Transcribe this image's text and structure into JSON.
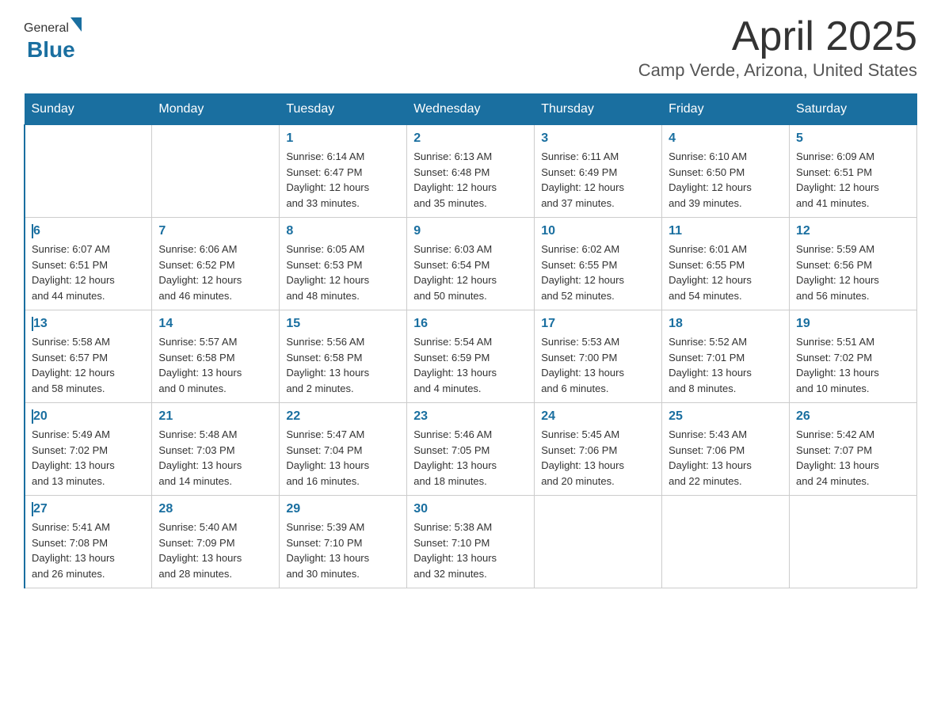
{
  "header": {
    "logo_general": "General",
    "logo_blue": "Blue",
    "month": "April 2025",
    "location": "Camp Verde, Arizona, United States"
  },
  "weekdays": [
    "Sunday",
    "Monday",
    "Tuesday",
    "Wednesday",
    "Thursday",
    "Friday",
    "Saturday"
  ],
  "weeks": [
    [
      {
        "day": "",
        "info": ""
      },
      {
        "day": "",
        "info": ""
      },
      {
        "day": "1",
        "info": "Sunrise: 6:14 AM\nSunset: 6:47 PM\nDaylight: 12 hours\nand 33 minutes."
      },
      {
        "day": "2",
        "info": "Sunrise: 6:13 AM\nSunset: 6:48 PM\nDaylight: 12 hours\nand 35 minutes."
      },
      {
        "day": "3",
        "info": "Sunrise: 6:11 AM\nSunset: 6:49 PM\nDaylight: 12 hours\nand 37 minutes."
      },
      {
        "day": "4",
        "info": "Sunrise: 6:10 AM\nSunset: 6:50 PM\nDaylight: 12 hours\nand 39 minutes."
      },
      {
        "day": "5",
        "info": "Sunrise: 6:09 AM\nSunset: 6:51 PM\nDaylight: 12 hours\nand 41 minutes."
      }
    ],
    [
      {
        "day": "6",
        "info": "Sunrise: 6:07 AM\nSunset: 6:51 PM\nDaylight: 12 hours\nand 44 minutes."
      },
      {
        "day": "7",
        "info": "Sunrise: 6:06 AM\nSunset: 6:52 PM\nDaylight: 12 hours\nand 46 minutes."
      },
      {
        "day": "8",
        "info": "Sunrise: 6:05 AM\nSunset: 6:53 PM\nDaylight: 12 hours\nand 48 minutes."
      },
      {
        "day": "9",
        "info": "Sunrise: 6:03 AM\nSunset: 6:54 PM\nDaylight: 12 hours\nand 50 minutes."
      },
      {
        "day": "10",
        "info": "Sunrise: 6:02 AM\nSunset: 6:55 PM\nDaylight: 12 hours\nand 52 minutes."
      },
      {
        "day": "11",
        "info": "Sunrise: 6:01 AM\nSunset: 6:55 PM\nDaylight: 12 hours\nand 54 minutes."
      },
      {
        "day": "12",
        "info": "Sunrise: 5:59 AM\nSunset: 6:56 PM\nDaylight: 12 hours\nand 56 minutes."
      }
    ],
    [
      {
        "day": "13",
        "info": "Sunrise: 5:58 AM\nSunset: 6:57 PM\nDaylight: 12 hours\nand 58 minutes."
      },
      {
        "day": "14",
        "info": "Sunrise: 5:57 AM\nSunset: 6:58 PM\nDaylight: 13 hours\nand 0 minutes."
      },
      {
        "day": "15",
        "info": "Sunrise: 5:56 AM\nSunset: 6:58 PM\nDaylight: 13 hours\nand 2 minutes."
      },
      {
        "day": "16",
        "info": "Sunrise: 5:54 AM\nSunset: 6:59 PM\nDaylight: 13 hours\nand 4 minutes."
      },
      {
        "day": "17",
        "info": "Sunrise: 5:53 AM\nSunset: 7:00 PM\nDaylight: 13 hours\nand 6 minutes."
      },
      {
        "day": "18",
        "info": "Sunrise: 5:52 AM\nSunset: 7:01 PM\nDaylight: 13 hours\nand 8 minutes."
      },
      {
        "day": "19",
        "info": "Sunrise: 5:51 AM\nSunset: 7:02 PM\nDaylight: 13 hours\nand 10 minutes."
      }
    ],
    [
      {
        "day": "20",
        "info": "Sunrise: 5:49 AM\nSunset: 7:02 PM\nDaylight: 13 hours\nand 13 minutes."
      },
      {
        "day": "21",
        "info": "Sunrise: 5:48 AM\nSunset: 7:03 PM\nDaylight: 13 hours\nand 14 minutes."
      },
      {
        "day": "22",
        "info": "Sunrise: 5:47 AM\nSunset: 7:04 PM\nDaylight: 13 hours\nand 16 minutes."
      },
      {
        "day": "23",
        "info": "Sunrise: 5:46 AM\nSunset: 7:05 PM\nDaylight: 13 hours\nand 18 minutes."
      },
      {
        "day": "24",
        "info": "Sunrise: 5:45 AM\nSunset: 7:06 PM\nDaylight: 13 hours\nand 20 minutes."
      },
      {
        "day": "25",
        "info": "Sunrise: 5:43 AM\nSunset: 7:06 PM\nDaylight: 13 hours\nand 22 minutes."
      },
      {
        "day": "26",
        "info": "Sunrise: 5:42 AM\nSunset: 7:07 PM\nDaylight: 13 hours\nand 24 minutes."
      }
    ],
    [
      {
        "day": "27",
        "info": "Sunrise: 5:41 AM\nSunset: 7:08 PM\nDaylight: 13 hours\nand 26 minutes."
      },
      {
        "day": "28",
        "info": "Sunrise: 5:40 AM\nSunset: 7:09 PM\nDaylight: 13 hours\nand 28 minutes."
      },
      {
        "day": "29",
        "info": "Sunrise: 5:39 AM\nSunset: 7:10 PM\nDaylight: 13 hours\nand 30 minutes."
      },
      {
        "day": "30",
        "info": "Sunrise: 5:38 AM\nSunset: 7:10 PM\nDaylight: 13 hours\nand 32 minutes."
      },
      {
        "day": "",
        "info": ""
      },
      {
        "day": "",
        "info": ""
      },
      {
        "day": "",
        "info": ""
      }
    ]
  ]
}
